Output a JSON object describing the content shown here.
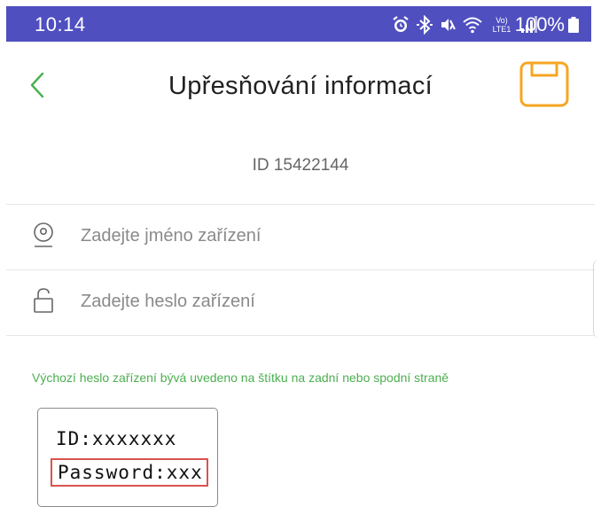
{
  "status_bar": {
    "time": "10:14",
    "network_label": "Vo) LTE1",
    "battery_percent": "100%",
    "background_color": "#4f4fc0"
  },
  "header": {
    "title": "Upřesňování informací",
    "back_icon": "chevron-left-icon",
    "save_icon": "floppy-disk-icon",
    "accent_color": "#4caf50",
    "save_color": "#f5a623"
  },
  "device": {
    "id_text": "ID 15422144"
  },
  "form": {
    "name_placeholder": "Zadejte jméno zařízení",
    "name_value": "",
    "name_icon": "location-pin-icon",
    "password_placeholder": "Zadejte heslo zařízení",
    "password_value": "",
    "password_icon": "unlock-icon"
  },
  "hint": {
    "text": "Výchozí heslo zařízení bývá uvedeno na štítku na zadní nebo spodní straně",
    "color": "#4caf50"
  },
  "example_label": {
    "id_line": "ID:xxxxxxx",
    "password_line": "Password:xxx",
    "highlight_color": "#d9534f"
  }
}
